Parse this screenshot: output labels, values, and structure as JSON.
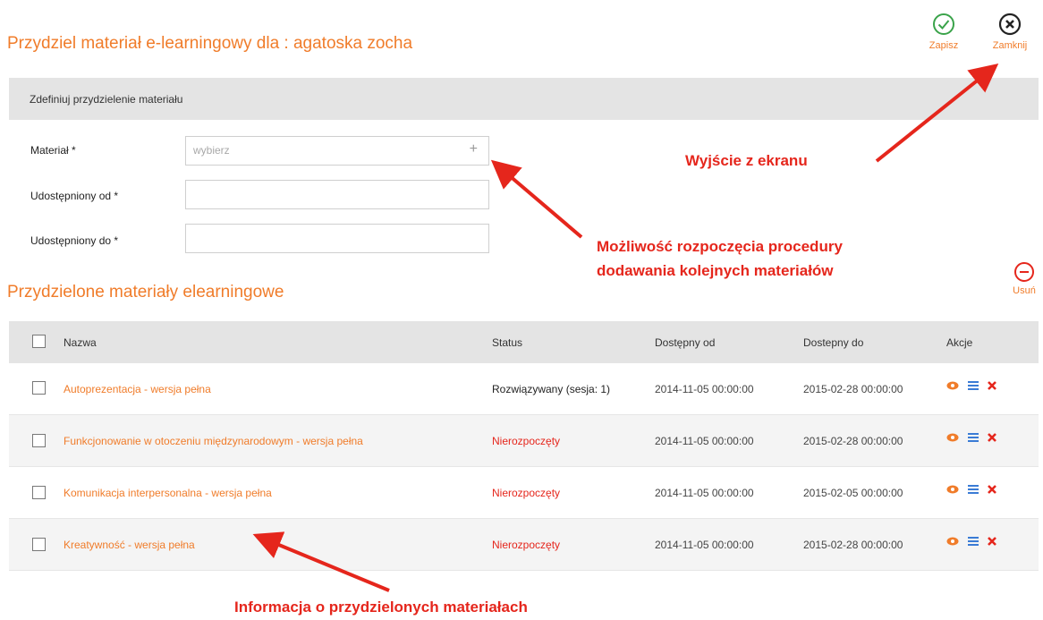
{
  "header": {
    "title": "Przydziel materiał e-learningowy dla : agatoska zocha"
  },
  "toolbar": {
    "save_label": "Zapisz",
    "close_label": "Zamknij",
    "remove_label": "Usuń"
  },
  "define_section": {
    "title": "Zdefiniuj przydzielenie materiału"
  },
  "form": {
    "material_label": "Materiał *",
    "material_placeholder": "wybierz",
    "material_add_icon": "+",
    "from_label": "Udostępniony od *",
    "to_label": "Udostępniony do *"
  },
  "assigned_section": {
    "title": "Przydzielone materiały elearningowe"
  },
  "table": {
    "headers": {
      "name": "Nazwa",
      "status": "Status",
      "from": "Dostępny od",
      "to": "Dostepny do",
      "actions": "Akcje"
    },
    "rows": [
      {
        "name": "Autoprezentacja - wersja pełna",
        "status": "Rozwiązywany (sesja: 1)",
        "from": "2014-11-05 00:00:00",
        "to": "2015-02-28 00:00:00"
      },
      {
        "name": "Funkcjonowanie w otoczeniu międzynarodowym - wersja pełna",
        "status": "Nierozpoczęty",
        "from": "2014-11-05 00:00:00",
        "to": "2015-02-28 00:00:00"
      },
      {
        "name": "Komunikacja interpersonalna - wersja pełna",
        "status": "Nierozpoczęty",
        "from": "2014-11-05 00:00:00",
        "to": "2015-02-05 00:00:00"
      },
      {
        "name": "Kreatywność - wersja pełna",
        "status": "Nierozpoczęty",
        "from": "2014-11-05 00:00:00",
        "to": "2015-02-28 00:00:00"
      }
    ]
  },
  "annotations": {
    "exit": "Wyjście z ekranu",
    "add_line1": "Możliwość rozpoczęcia procedury",
    "add_line2": "dodawania kolejnych materiałów",
    "info": "Informacja o przydzielonych materiałach"
  },
  "icons": {
    "save": "check-circle-icon",
    "close": "x-circle-icon",
    "remove": "minus-circle-icon",
    "view": "eye-icon",
    "details": "list-icon",
    "delete": "x-icon"
  },
  "colors": {
    "accent": "#f07c2a",
    "save_green": "#3aa34a",
    "status_red": "#e5261c",
    "annotation_red": "#e5261c",
    "list_blue": "#3a7bd5"
  }
}
